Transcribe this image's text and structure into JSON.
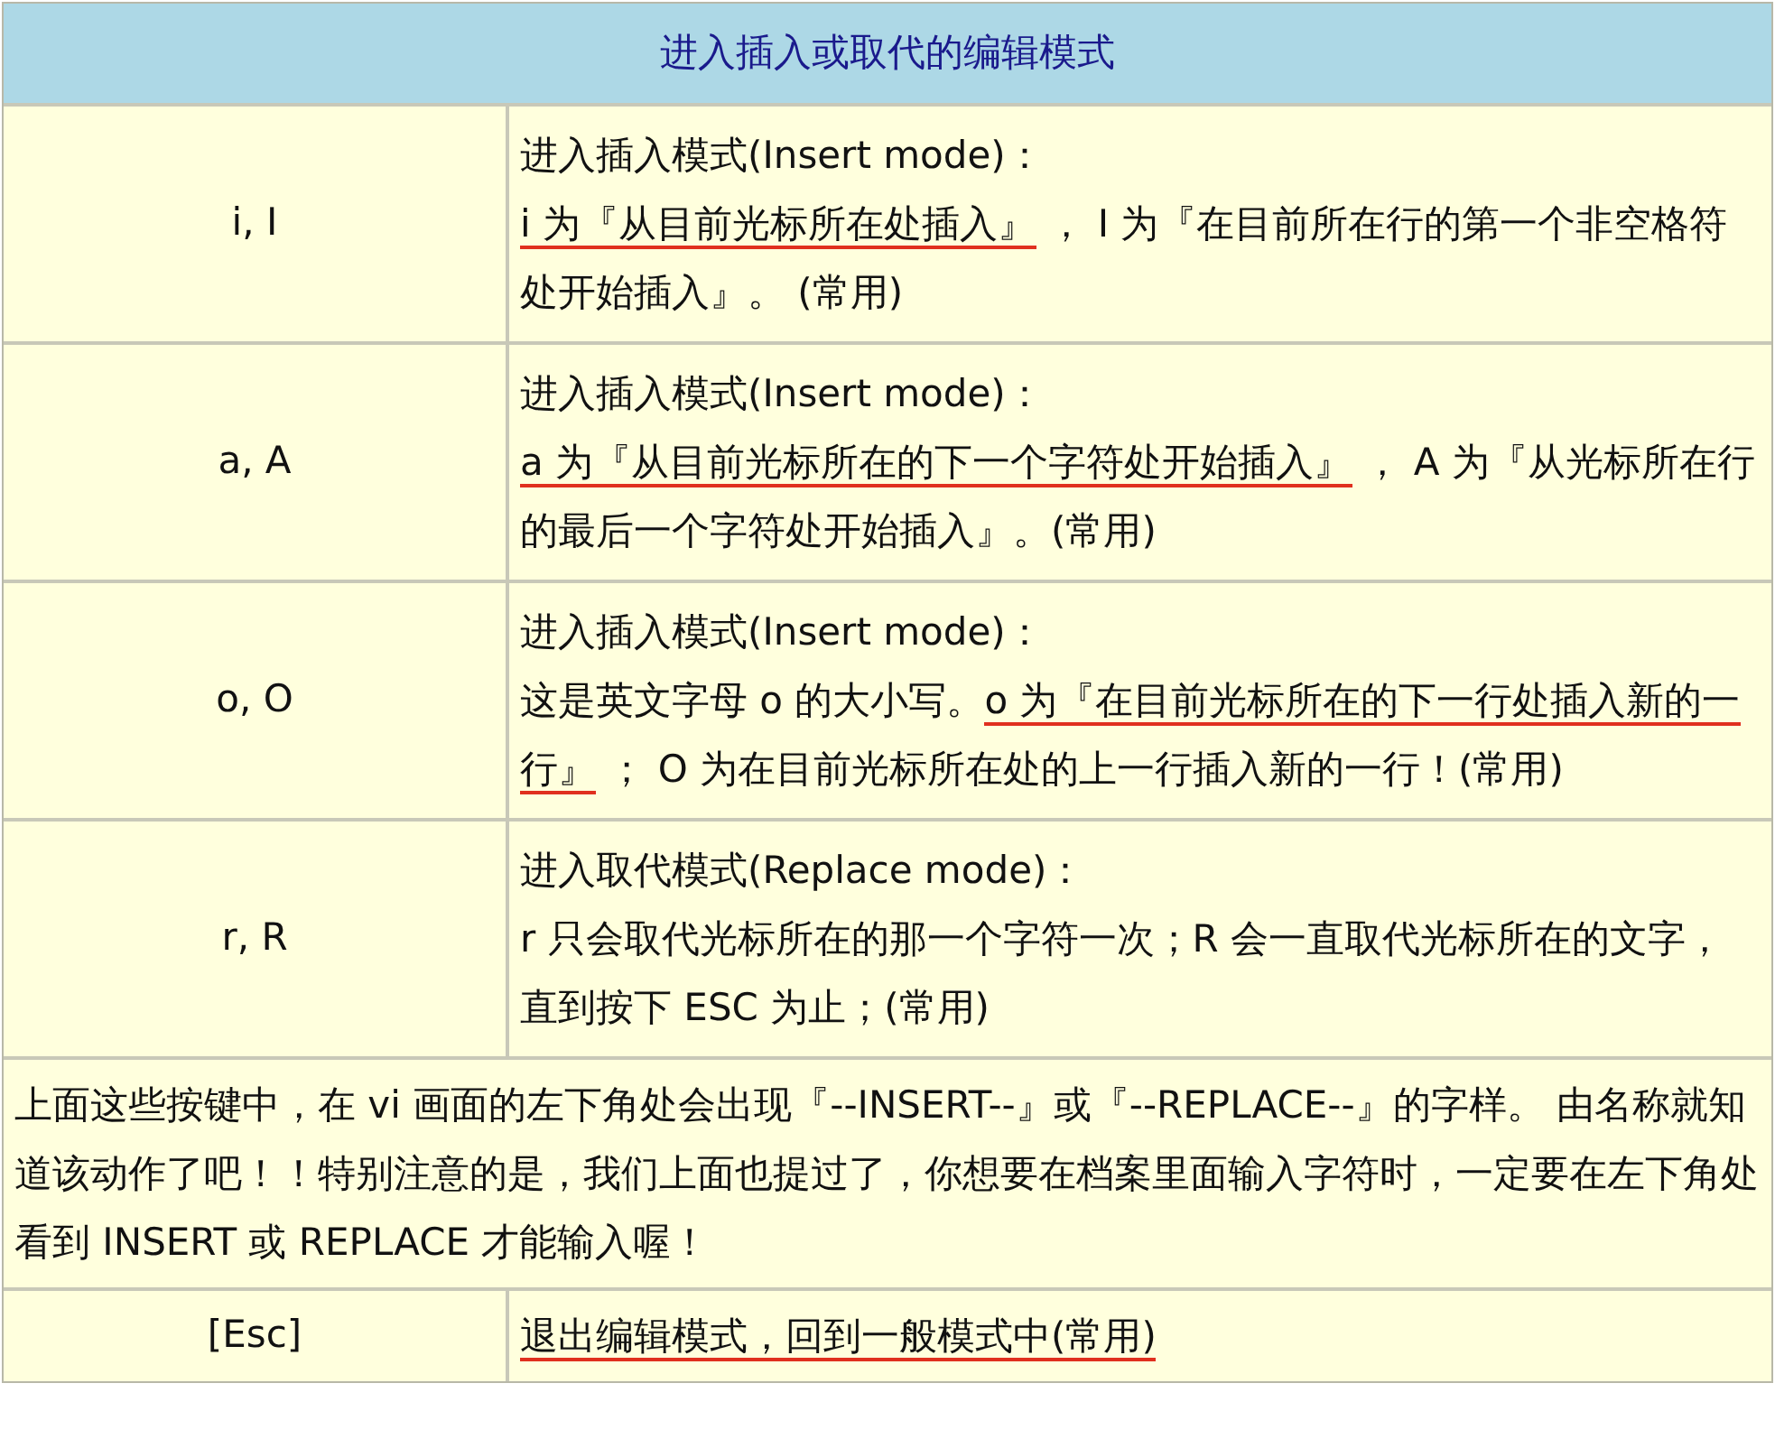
{
  "title": "进入插入或取代的编辑模式",
  "rows": [
    {
      "key": "i, I",
      "heading": "进入插入模式(Insert mode)：",
      "body": [
        {
          "text": "i 为『从目前光标所在处插入』",
          "underlined": true
        },
        {
          "text": " ， I 为『在目前所在行的第一个非空格符处开始插入』。 (常用)",
          "underlined": false
        }
      ]
    },
    {
      "key": "a, A",
      "heading": "进入插入模式(Insert mode)：",
      "body": [
        {
          "text": "a 为『从目前光标所在的下一个字符处开始插入』",
          "underlined": true
        },
        {
          "text": " ， A 为『从光标所在行的最后一个字符处开始插入』。(常用)",
          "underlined": false
        }
      ]
    },
    {
      "key": "o, O",
      "heading": "进入插入模式(Insert mode)：",
      "body": [
        {
          "text": "这是英文字母 o 的大小写。",
          "underlined": false
        },
        {
          "text": "o 为『在目前光标所在的下一行处插入新的一行』",
          "underlined": true
        },
        {
          "text": " ； O 为在目前光标所在处的上一行插入新的一行！(常用)",
          "underlined": false
        }
      ]
    },
    {
      "key": "r, R",
      "heading": "进入取代模式(Replace mode)：",
      "body": [
        {
          "text": "r 只会取代光标所在的那一个字符一次；R 会一直取代光标所在的文字，直到按下 ESC 为止；(常用)",
          "underlined": false
        }
      ]
    }
  ],
  "note": "上面这些按键中，在 vi 画面的左下角处会出现『--INSERT--』或『--REPLACE--』的字样。 由名称就知道该动作了吧！！特别注意的是，我们上面也提过了，你想要在档案里面输入字符时，一定要在左下角处看到 INSERT 或 REPLACE 才能输入喔！",
  "last_row": {
    "key": "[Esc]",
    "body": [
      {
        "text": "退出编辑模式，回到一般模式中(常用)",
        "underlined": true
      }
    ]
  }
}
